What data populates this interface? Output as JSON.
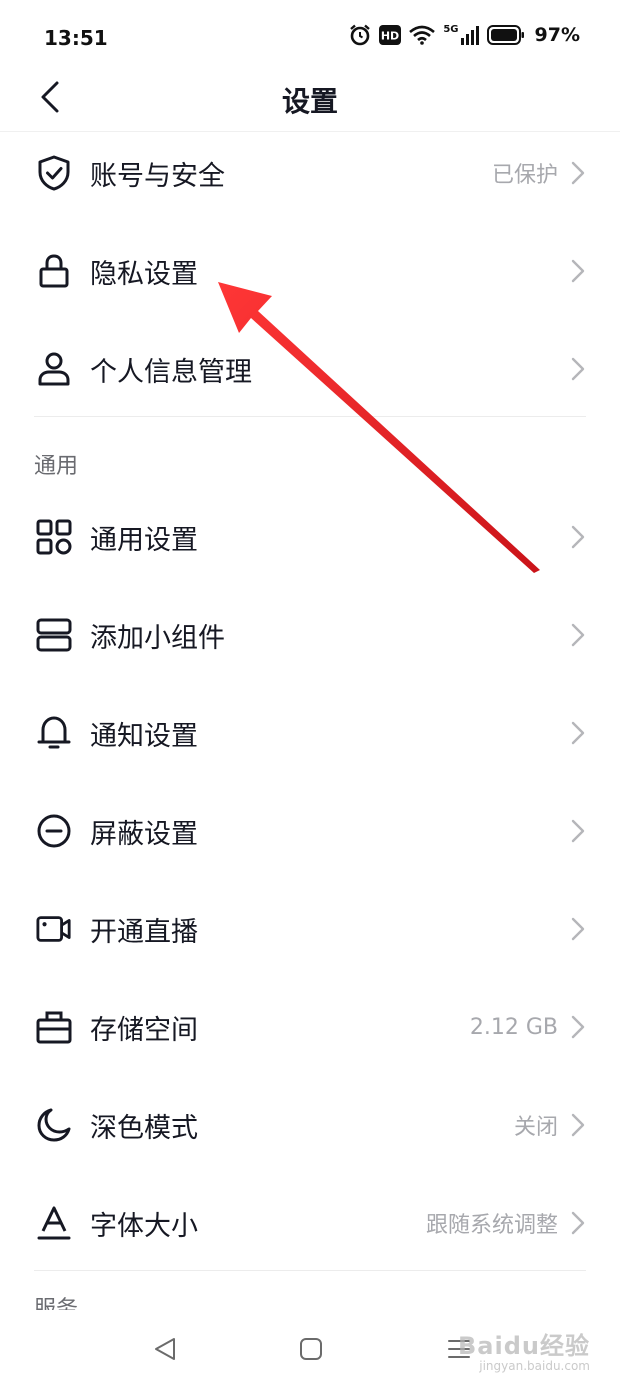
{
  "status_bar": {
    "time": "13:51",
    "network": "5G",
    "battery": "97%"
  },
  "header": {
    "title": "设置"
  },
  "account_section": [
    {
      "label": "账号与安全",
      "value": "已保护",
      "icon": "shield-check-icon"
    },
    {
      "label": "隐私设置",
      "value": "",
      "icon": "lock-icon"
    },
    {
      "label": "个人信息管理",
      "value": "",
      "icon": "person-icon"
    }
  ],
  "general_section": {
    "header": "通用",
    "items": [
      {
        "label": "通用设置",
        "value": "",
        "icon": "grid-icon"
      },
      {
        "label": "添加小组件",
        "value": "",
        "icon": "widget-icon"
      },
      {
        "label": "通知设置",
        "value": "",
        "icon": "bell-icon"
      },
      {
        "label": "屏蔽设置",
        "value": "",
        "icon": "block-icon"
      },
      {
        "label": "开通直播",
        "value": "",
        "icon": "video-camera-icon"
      },
      {
        "label": "存储空间",
        "value": "2.12 GB",
        "icon": "storage-box-icon"
      },
      {
        "label": "深色模式",
        "value": "关闭",
        "icon": "moon-icon"
      },
      {
        "label": "字体大小",
        "value": "跟随系统调整",
        "icon": "font-size-icon"
      }
    ]
  },
  "service_section": {
    "header": "服务"
  },
  "watermark": {
    "brand": "Baidu经验",
    "site": "jingyan.baidu.com"
  },
  "colors": {
    "text_primary": "#161823",
    "text_secondary": "#a7a8ad",
    "annotation_arrow": "#e8131b"
  }
}
